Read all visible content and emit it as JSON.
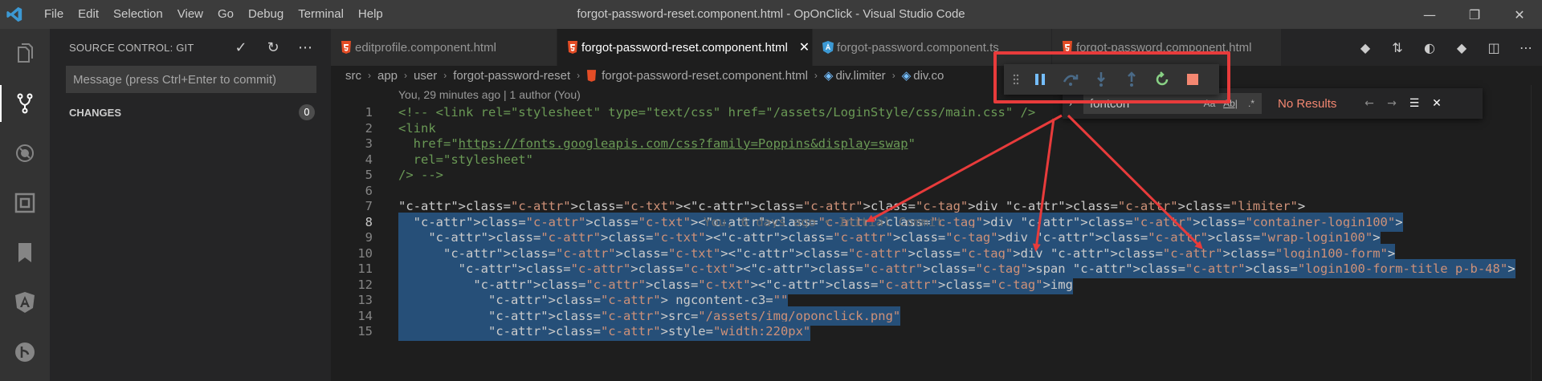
{
  "window": {
    "title": "forgot-password-reset.component.html - OpOnClick - Visual Studio Code",
    "menu": [
      "File",
      "Edit",
      "Selection",
      "View",
      "Go",
      "Debug",
      "Terminal",
      "Help"
    ],
    "controls": [
      "—",
      "❐",
      "✕"
    ]
  },
  "activity_bar": [
    "explorer-icon",
    "source-control-icon",
    "debug-icon",
    "extensions-icon",
    "bookmark-icon",
    "angular-icon",
    "git-graph-icon"
  ],
  "sidebar": {
    "title": "SOURCE CONTROL: GIT",
    "commit_placeholder": "Message (press Ctrl+Enter to commit)",
    "changes_label": "CHANGES",
    "changes_count": "0"
  },
  "tabs": [
    {
      "label": "editprofile.component.html",
      "icon": "html-icon",
      "active": false
    },
    {
      "label": "forgot-password-reset.component.html",
      "icon": "html-icon",
      "active": true
    },
    {
      "label": "forgot-password.component.ts",
      "icon": "angular-icon",
      "active": false
    },
    {
      "label": "forgot-password.component.html",
      "icon": "html-icon",
      "active": false
    }
  ],
  "breadcrumb": [
    "src",
    "app",
    "user",
    "forgot-password-reset",
    "forgot-password-reset.component.html",
    "div.limiter",
    "div.co"
  ],
  "editor": {
    "codelens": "You, 29 minutes ago | 1 author (You)",
    "blame": "You, 6 days ago • Initial Commit",
    "lines": [
      {
        "n": "1",
        "text": "<!-- <link rel=\"stylesheet\" type=\"text/css\" href=\"/assets/LoginStyle/css/main.css\" />"
      },
      {
        "n": "2",
        "text": "<link"
      },
      {
        "n": "3",
        "text": "  href=\"https://fonts.googleapis.com/css?family=Poppins&display=swap\""
      },
      {
        "n": "4",
        "text": "  rel=\"stylesheet\""
      },
      {
        "n": "5",
        "text": "/> -->"
      },
      {
        "n": "6",
        "text": ""
      },
      {
        "n": "7",
        "text": "<div class=\"limiter\">"
      },
      {
        "n": "8",
        "text": "  <div class=\"container-login100\">"
      },
      {
        "n": "9",
        "text": "    <div class=\"wrap-login100\">"
      },
      {
        "n": "10",
        "text": "      <div class=\"login100-form\">"
      },
      {
        "n": "11",
        "text": "        <span class=\"login100-form-title p-b-48\">"
      },
      {
        "n": "12",
        "text": "          <img"
      },
      {
        "n": "13",
        "text": "            _ngcontent-c3=\"\""
      },
      {
        "n": "14",
        "text": "            src=\"/assets/img/oponclick.png\""
      },
      {
        "n": "15",
        "text": "            style=\"width:220px\""
      }
    ]
  },
  "find_widget": {
    "query": "fontcon",
    "options": [
      "Aa",
      "Ab|",
      ".*"
    ],
    "result": "No Results"
  },
  "debug_toolbar": [
    "grip-icon",
    "pause-icon",
    "step-over-icon",
    "step-into-icon",
    "step-out-icon",
    "restart-icon",
    "stop-icon"
  ],
  "colors": {
    "accent_red": "#e83b3b",
    "pause_blue": "#75beff",
    "restart_green": "#89d185",
    "stop_orange": "#f48771"
  }
}
